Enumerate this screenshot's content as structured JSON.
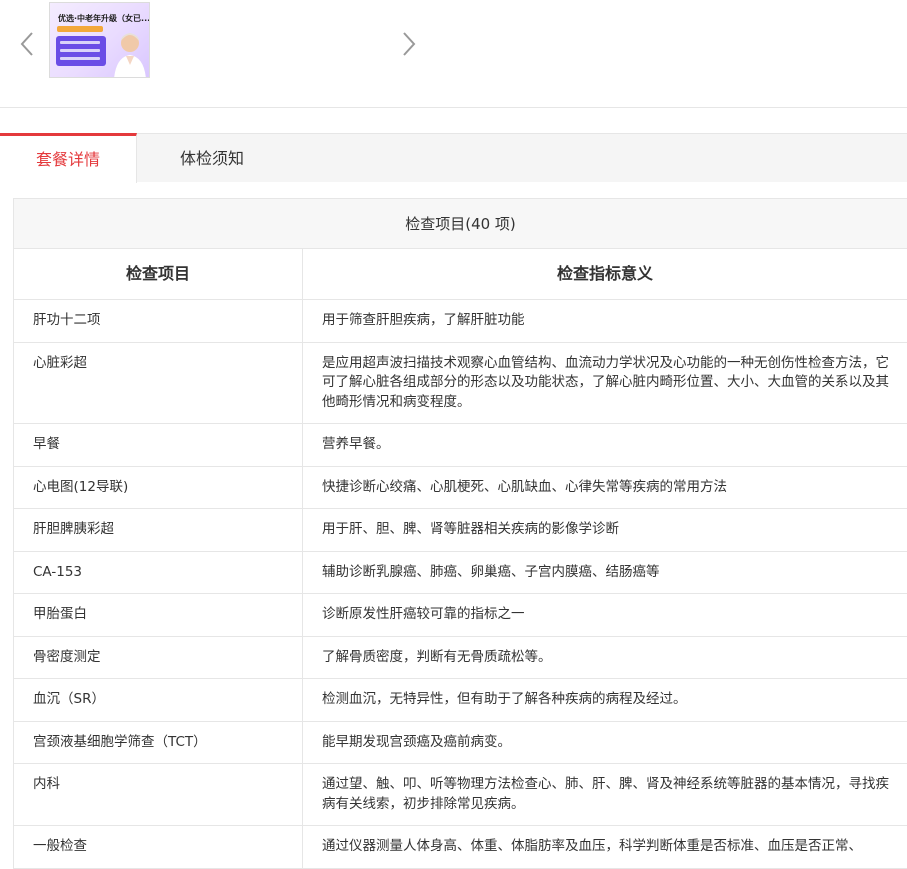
{
  "carousel": {
    "thumb_title": "优选·中老年升级（女已...",
    "prev_icon": "chevron-left-icon",
    "next_icon": "chevron-right-icon"
  },
  "tabs": [
    {
      "label": "套餐详情",
      "active": true
    },
    {
      "label": "体检须知",
      "active": false
    }
  ],
  "table": {
    "caption": "检查项目(40 项)",
    "headers": [
      "检查项目",
      "检查指标意义"
    ],
    "rows": [
      {
        "name": "肝功十二项",
        "desc": "用于筛查肝胆疾病，了解肝脏功能"
      },
      {
        "name": "心脏彩超",
        "desc": "是应用超声波扫描技术观察心血管结构、血流动力学状况及心功能的一种无创伤性检查方法，它可了解心脏各组成部分的形态以及功能状态，了解心脏内畸形位置、大小、大血管的关系以及其他畸形情况和病变程度。"
      },
      {
        "name": "早餐",
        "desc": "营养早餐。"
      },
      {
        "name": "心电图(12导联)",
        "desc": "快捷诊断心绞痛、心肌梗死、心肌缺血、心律失常等疾病的常用方法"
      },
      {
        "name": "肝胆脾胰彩超",
        "desc": "用于肝、胆、脾、肾等脏器相关疾病的影像学诊断"
      },
      {
        "name": "CA-153",
        "desc": "辅助诊断乳腺癌、肺癌、卵巢癌、子宫内膜癌、结肠癌等"
      },
      {
        "name": "甲胎蛋白",
        "desc": "诊断原发性肝癌较可靠的指标之一"
      },
      {
        "name": "骨密度测定",
        "desc": "了解骨质密度，判断有无骨质疏松等。"
      },
      {
        "name": "血沉（SR）",
        "desc": "检测血沉，无特异性，但有助于了解各种疾病的病程及经过。"
      },
      {
        "name": "宫颈液基细胞学筛查（TCT）",
        "desc": "能早期发现宫颈癌及癌前病变。"
      },
      {
        "name": "内科",
        "desc": "通过望、触、叩、听等物理方法检查心、肺、肝、脾、肾及神经系统等脏器的基本情况，寻找疾病有关线索，初步排除常见疾病。"
      },
      {
        "name": "一般检查",
        "desc": "通过仪器测量人体身高、体重、体脂肪率及血压，科学判断体重是否标准、血压是否正常、"
      }
    ]
  },
  "colors": {
    "accent": "#e4393c",
    "border": "#e6e6e6",
    "header_bg": "#f7f7f7",
    "text": "#333333"
  }
}
